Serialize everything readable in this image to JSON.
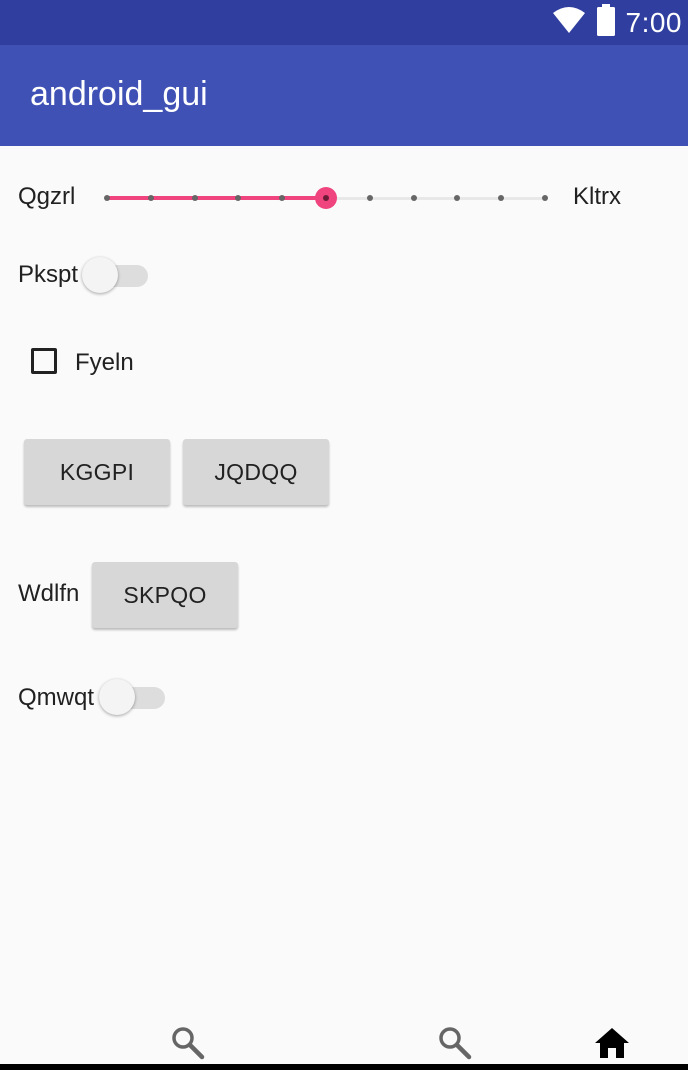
{
  "status_bar": {
    "time": "7:00",
    "icons": [
      "wifi-icon",
      "battery-icon"
    ]
  },
  "app_bar": {
    "title": "android_gui"
  },
  "seekbar": {
    "left_label": "Qgzrl",
    "right_label": "Kltrx",
    "ticks": 11,
    "value": 5,
    "accent": "#f0447f"
  },
  "switch_1": {
    "label": "Pkspt",
    "checked": false
  },
  "checkbox": {
    "label": "Fyeln",
    "checked": false
  },
  "buttons_row": {
    "button_1": "KGGPI",
    "button_2": "JQDQQ"
  },
  "wdlfn_row": {
    "label": "Wdlfn",
    "button": "SKPQO"
  },
  "switch_2": {
    "label": "Qmwqt",
    "checked": false
  },
  "bottom_nav": {
    "icons": [
      "search-icon",
      "search-icon",
      "home-icon"
    ]
  },
  "colors": {
    "primary": "#3f51b5",
    "primary_dark": "#303f9f",
    "background": "#fafafa"
  }
}
